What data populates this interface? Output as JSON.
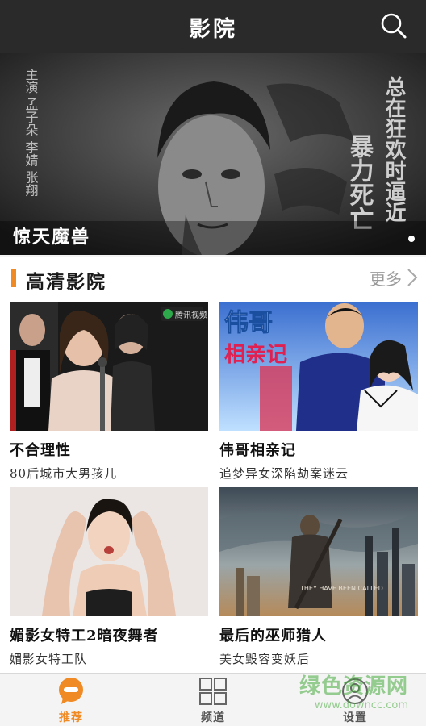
{
  "header": {
    "title": "影院",
    "search_icon": "search-icon"
  },
  "banner": {
    "title": "惊天魔兽",
    "poster_text_1": "暴力死亡",
    "poster_text_2": "总在狂欢时逼近",
    "poster_text_3": "主演 孟子朵 李婧 张翔"
  },
  "section": {
    "title": "高清影院",
    "more_label": "更多",
    "accent": "#f08a24"
  },
  "cards": [
    {
      "title": "不合理性",
      "subtitle": "80后城市大男孩儿",
      "badge": "腾讯视频"
    },
    {
      "title": "伟哥相亲记",
      "subtitle": "追梦异女深陷劫案迷云",
      "poster_line_1": "伟哥",
      "poster_line_2": "相亲记"
    },
    {
      "title": "媚影女特工2暗夜舞者",
      "subtitle": "媚影女特工队"
    },
    {
      "title": "最后的巫师猎人",
      "subtitle": "美女毁容变妖后",
      "poster_text": "THEY HAVE BEEN CALLED"
    }
  ],
  "tabbar": {
    "tabs": [
      {
        "label": "推荐",
        "icon": "chat-bubble-icon"
      },
      {
        "label": "频道",
        "icon": "grid-icon"
      },
      {
        "label": "设置",
        "icon": "settings-icon"
      }
    ]
  },
  "watermark": {
    "text": "绿色资源网",
    "url": "www.downcc.com"
  }
}
